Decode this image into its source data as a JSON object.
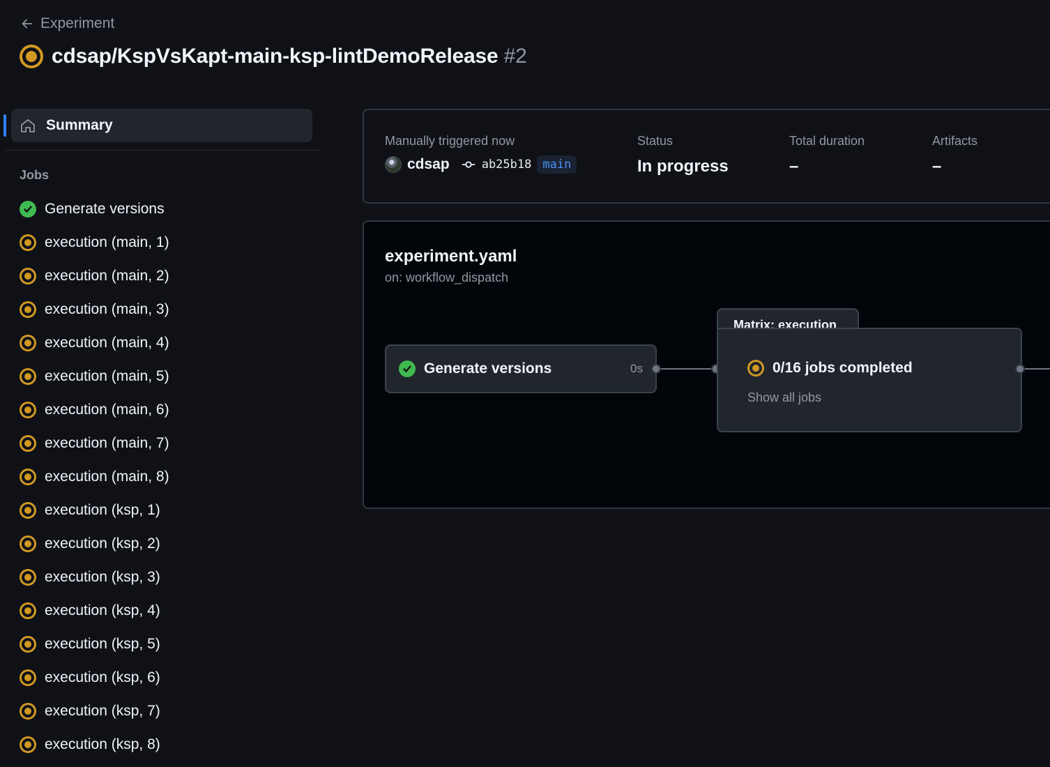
{
  "header": {
    "back_label": "Experiment",
    "title": "cdsap/KspVsKapt-main-ksp-lintDemoRelease",
    "run_number": "#2"
  },
  "sidebar": {
    "summary_label": "Summary",
    "jobs_heading": "Jobs",
    "jobs": [
      {
        "label": "Generate versions",
        "status": "success"
      },
      {
        "label": "execution (main, 1)",
        "status": "in_progress"
      },
      {
        "label": "execution (main, 2)",
        "status": "in_progress"
      },
      {
        "label": "execution (main, 3)",
        "status": "in_progress"
      },
      {
        "label": "execution (main, 4)",
        "status": "in_progress"
      },
      {
        "label": "execution (main, 5)",
        "status": "in_progress"
      },
      {
        "label": "execution (main, 6)",
        "status": "in_progress"
      },
      {
        "label": "execution (main, 7)",
        "status": "in_progress"
      },
      {
        "label": "execution (main, 8)",
        "status": "in_progress"
      },
      {
        "label": "execution (ksp, 1)",
        "status": "in_progress"
      },
      {
        "label": "execution (ksp, 2)",
        "status": "in_progress"
      },
      {
        "label": "execution (ksp, 3)",
        "status": "in_progress"
      },
      {
        "label": "execution (ksp, 4)",
        "status": "in_progress"
      },
      {
        "label": "execution (ksp, 5)",
        "status": "in_progress"
      },
      {
        "label": "execution (ksp, 6)",
        "status": "in_progress"
      },
      {
        "label": "execution (ksp, 7)",
        "status": "in_progress"
      },
      {
        "label": "execution (ksp, 8)",
        "status": "in_progress"
      }
    ]
  },
  "summary": {
    "trigger_label": "Manually triggered now",
    "actor": "cdsap",
    "commit_sha": "ab25b18",
    "branch": "main",
    "status_label": "Status",
    "status_value": "In progress",
    "duration_label": "Total duration",
    "duration_value": "–",
    "artifacts_label": "Artifacts",
    "artifacts_value": "–"
  },
  "workflow": {
    "file": "experiment.yaml",
    "trigger": "on: workflow_dispatch",
    "job_node": {
      "label": "Generate versions",
      "duration": "0s",
      "status": "success"
    },
    "matrix": {
      "title": "Matrix: execution",
      "status_text": "0/16 jobs completed",
      "show_all": "Show all jobs"
    }
  },
  "colors": {
    "background": "#0f1117",
    "in_progress": "#d29922",
    "success": "#3fb950",
    "accent": "#2f81f7"
  }
}
